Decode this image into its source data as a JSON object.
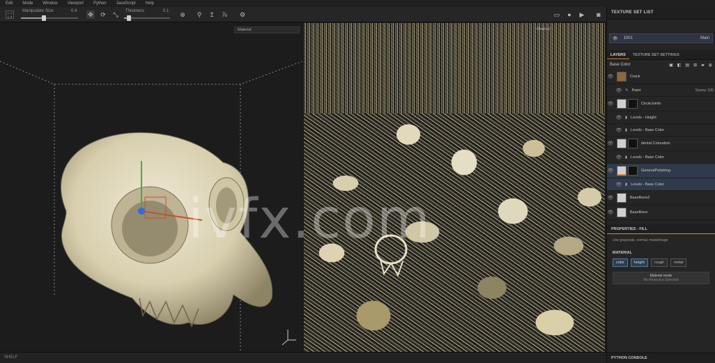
{
  "menu": [
    "Edit",
    "Mode",
    "Window",
    "Viewport",
    "Python",
    "JavaScript",
    "Help"
  ],
  "toolbar": {
    "size_label": "Manipulator Size",
    "size_value": "0.4",
    "size_level": 0.4,
    "thickness_label": "Thickness",
    "thickness_value": "0.1",
    "thickness_level": 0.1
  },
  "viewport3d": {
    "dropdown": "Material",
    "material_dropdown": "Material"
  },
  "right_panel": {
    "texture_set_list_title": "TEXTURE SET LIST",
    "texture_set_name": "1001",
    "texture_set_shader": "Main",
    "tabs": [
      "LAYERS",
      "TEXTURE SET SETTINGS"
    ],
    "channel_dropdown": "Base Color",
    "layers": [
      {
        "name": "Crack",
        "type": "folder",
        "selected": false
      },
      {
        "name": "Paint",
        "type": "paint",
        "extra": "Stamp 100"
      },
      {
        "name": "CircleJoints",
        "type": "fill",
        "selected": false
      },
      {
        "name": "Levels - Height",
        "type": "levels"
      },
      {
        "name": "Levels - Base Color",
        "type": "levels"
      },
      {
        "name": "dental Coloration",
        "type": "fill"
      },
      {
        "name": "Levels - Base Color",
        "type": "levels"
      },
      {
        "name": "GeneralPolishing",
        "type": "fill",
        "selected": true
      },
      {
        "name": "Levels - Base Color",
        "type": "levels"
      },
      {
        "name": "BaseBone2",
        "type": "fill"
      },
      {
        "name": "BaseBone",
        "type": "fill"
      }
    ],
    "properties_title": "PROPERTIES - FILL",
    "properties_sub": "Use grayscale, normal, mask/image",
    "material_label": "MATERIAL",
    "material_channels": [
      {
        "label": "color",
        "on": true
      },
      {
        "label": "height",
        "on": true
      },
      {
        "label": "rough",
        "on": false
      },
      {
        "label": "metal",
        "on": false
      }
    ],
    "material_mode_title": "Material mode",
    "material_mode_sub": "No Resource Selected",
    "python_console": "PYTHON CONSOLE"
  },
  "watermark": "ivfx.com",
  "status": "SHELF"
}
